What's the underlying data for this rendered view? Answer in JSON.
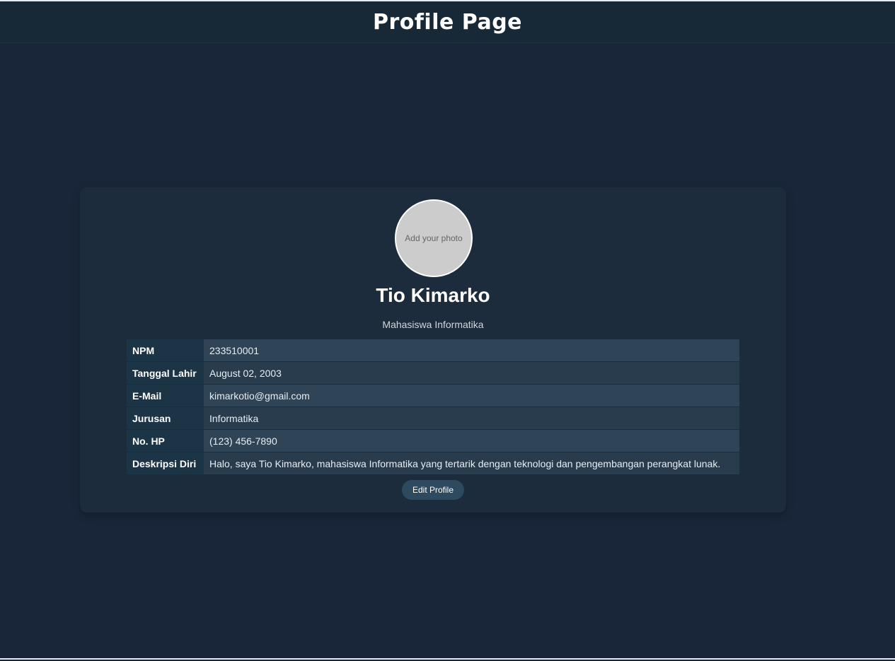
{
  "header": {
    "title": "Profile Page"
  },
  "profile": {
    "photo_placeholder": "Add your photo",
    "name": "Tio Kimarko",
    "subtitle": "Mahasiswa Informatika"
  },
  "details": [
    {
      "label": "NPM",
      "value": "233510001"
    },
    {
      "label": "Tanggal Lahir",
      "value": "August 02, 2003"
    },
    {
      "label": "E-Mail",
      "value": "kimarkotio@gmail.com"
    },
    {
      "label": "Jurusan",
      "value": "Informatika"
    },
    {
      "label": "No. HP",
      "value": "(123) 456-7890"
    },
    {
      "label": "Deskripsi Diri",
      "value": "Halo, saya Tio Kimarko, mahasiswa Informatika yang tertarik dengan teknologi dan pengembangan perangkat lunak."
    }
  ],
  "actions": {
    "edit_label": "Edit Profile"
  },
  "colors": {
    "background": "#19263a",
    "header": "#172936",
    "card": "#1c2c3c",
    "button": "#2d4a5f"
  }
}
